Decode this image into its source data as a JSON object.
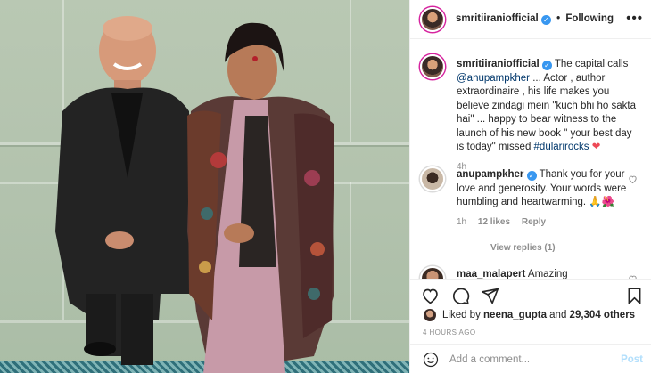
{
  "header": {
    "username": "smritiiraniofficial",
    "separator": "•",
    "follow_state": "Following",
    "more": "•••"
  },
  "caption": {
    "username": "smritiiraniofficial",
    "text_1": " The capital calls ",
    "mention": "@anupampkher",
    "text_2": " ... Actor , author extraordinaire , his life makes you believe zindagi mein \"kuch bhi ho sakta hai\" ... happy to bear witness to the launch of his new book \" your best day is today\" missed ",
    "hashtag": "#dularirocks",
    "emoji": "❤",
    "time": "4h"
  },
  "comment_1": {
    "username": "anupampkher",
    "text": " Thank you for your love and generosity. Your words were humbling and heartwarming. 🙏🌺",
    "time": "1h",
    "likes": "12 likes",
    "reply": "Reply",
    "view_replies": "View replies (1)"
  },
  "comment_2": {
    "username": "maa_malapert",
    "text": " Amazing"
  },
  "likes": {
    "prefix": "Liked by ",
    "user": "neena_gupta",
    "middle": " and ",
    "count": "29,304 others"
  },
  "timestamp": "4 HOURS AGO",
  "add_comment": {
    "placeholder": "Add a comment...",
    "post": "Post"
  },
  "icons": {
    "like": "heart-icon",
    "comment": "comment-icon",
    "share": "share-icon",
    "save": "bookmark-icon",
    "emoji": "smiley-icon"
  },
  "colors": {
    "link": "#00376b",
    "verified": "#3897f0",
    "muted": "#8e8e8e",
    "post_disabled": "#b2dffc",
    "heart": "#ed4956"
  }
}
